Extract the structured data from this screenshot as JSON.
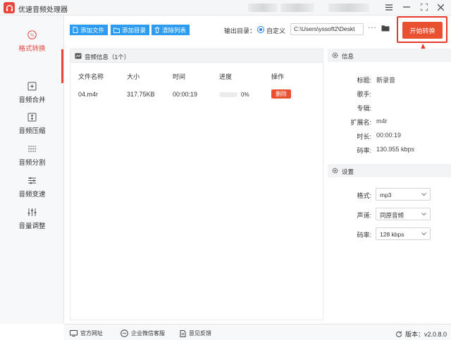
{
  "app": {
    "title": "优速音频处理器"
  },
  "window": {
    "controls": [
      "menu-icon",
      "minimize-icon",
      "maximize-icon",
      "close-icon"
    ]
  },
  "sidebar": {
    "items": [
      {
        "label": "格式转换",
        "icon": "format-convert-icon",
        "active": true
      },
      {
        "label": "音频合并",
        "icon": "merge-icon",
        "active": false
      },
      {
        "label": "音频压缩",
        "icon": "compress-icon",
        "active": false
      },
      {
        "label": "音频分割",
        "icon": "split-icon",
        "active": false
      },
      {
        "label": "音频变速",
        "icon": "speed-icon",
        "active": false
      },
      {
        "label": "音量调整",
        "icon": "volume-adjust-icon",
        "active": false
      }
    ]
  },
  "toolbar": {
    "add_file": "添加文件",
    "add_folder": "添加目录",
    "clear_list": "清除列表",
    "output_label": "输出目录：",
    "custom_option": "自定义",
    "output_path": "C:\\Users\\yssoft2\\Deskt",
    "more": "···",
    "start_button": "开始转换",
    "accent_color": "#2d9cf0",
    "start_color": "#e8502f"
  },
  "file_list": {
    "title": "音频信息（1个）",
    "columns": [
      "文件名称",
      "大小",
      "时间",
      "进度",
      "操作"
    ],
    "rows": [
      {
        "name": "04.m4r",
        "size": "317.75KB",
        "duration": "00:00:19",
        "progress": 0,
        "progress_text": "0%",
        "action": "删除"
      }
    ]
  },
  "info": {
    "title": "信息",
    "fields": [
      {
        "label": "标题:",
        "value": "新录音"
      },
      {
        "label": "歌手:",
        "value": ""
      },
      {
        "label": "专辑:",
        "value": ""
      },
      {
        "label": "扩展名:",
        "value": "m4r"
      },
      {
        "label": "时长:",
        "value": "00:00:19"
      },
      {
        "label": "码率:",
        "value": "130.955 kbps"
      }
    ]
  },
  "settings": {
    "title": "设置",
    "fields": [
      {
        "label": "格式:",
        "value": "mp3"
      },
      {
        "label": "声道:",
        "value": "同原音频"
      },
      {
        "label": "码率:",
        "value": "128 kbps"
      }
    ]
  },
  "footer": {
    "website": "官方网址",
    "wechat": "企业微信客服",
    "feedback": "意见反馈",
    "version": "版本：v2.0.8.0"
  }
}
